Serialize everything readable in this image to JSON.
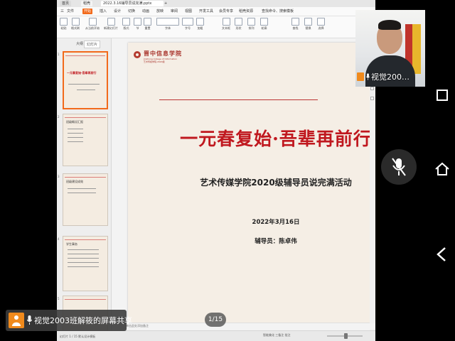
{
  "tabs": {
    "home": "首页",
    "wps": "稻壳",
    "file": "2022.3.16辅导员说完满.pptx",
    "add": "+"
  },
  "menu": [
    "三",
    "文件",
    "开始",
    "插入",
    "设计",
    "切换",
    "动画",
    "放映",
    "审阅",
    "视图",
    "开发工具",
    "会员专享",
    "稻壳资源",
    "查找命令、搜索模板"
  ],
  "menu_active_index": 2,
  "ribbon": [
    "粘贴",
    "格式刷",
    "从当前开始",
    "新建幻灯片",
    "版式",
    "节",
    "重置",
    "字体",
    "字号",
    "加粗",
    "文本框",
    "形状",
    "排列",
    "轮廓",
    "查找",
    "替换",
    "选择"
  ],
  "left_panel": {
    "tab_outline": "大纲",
    "tab_slides": "幻灯片",
    "thumbnails": [
      {
        "num": "1",
        "title": "一元春复始·吾辈再前行"
      },
      {
        "num": "2",
        "title": "班级概况汇报"
      },
      {
        "num": "3",
        "title": "班级建设成效"
      },
      {
        "num": "4",
        "title": "学生事务"
      },
      {
        "num": "5",
        "title": ""
      }
    ]
  },
  "slide": {
    "logo_name": "晋中信息学院",
    "logo_en": "Jinzhong College of Information",
    "logo_sub": "艺术传媒学院·2020级",
    "title": "一元春复始·吾辈再前行",
    "subtitle": "艺术传媒学院2020级辅导员说完满活动",
    "date": "2022年3月16日",
    "instructor": "辅导员：陈卓伟"
  },
  "notes_placeholder": "单击此处添加备注",
  "status": {
    "left": "幻灯片 1 / 15    默认设计模板",
    "right": "智能美化    三备注    批注"
  },
  "overlay": {
    "page_counter": "1/15",
    "share_text": "视觉2003班解筱的屏幕共享",
    "cam_name": "视觉200…"
  },
  "colors": {
    "accent": "#f26a1b",
    "title_red": "#c0181f",
    "slide_bg": "#f5eee5"
  }
}
